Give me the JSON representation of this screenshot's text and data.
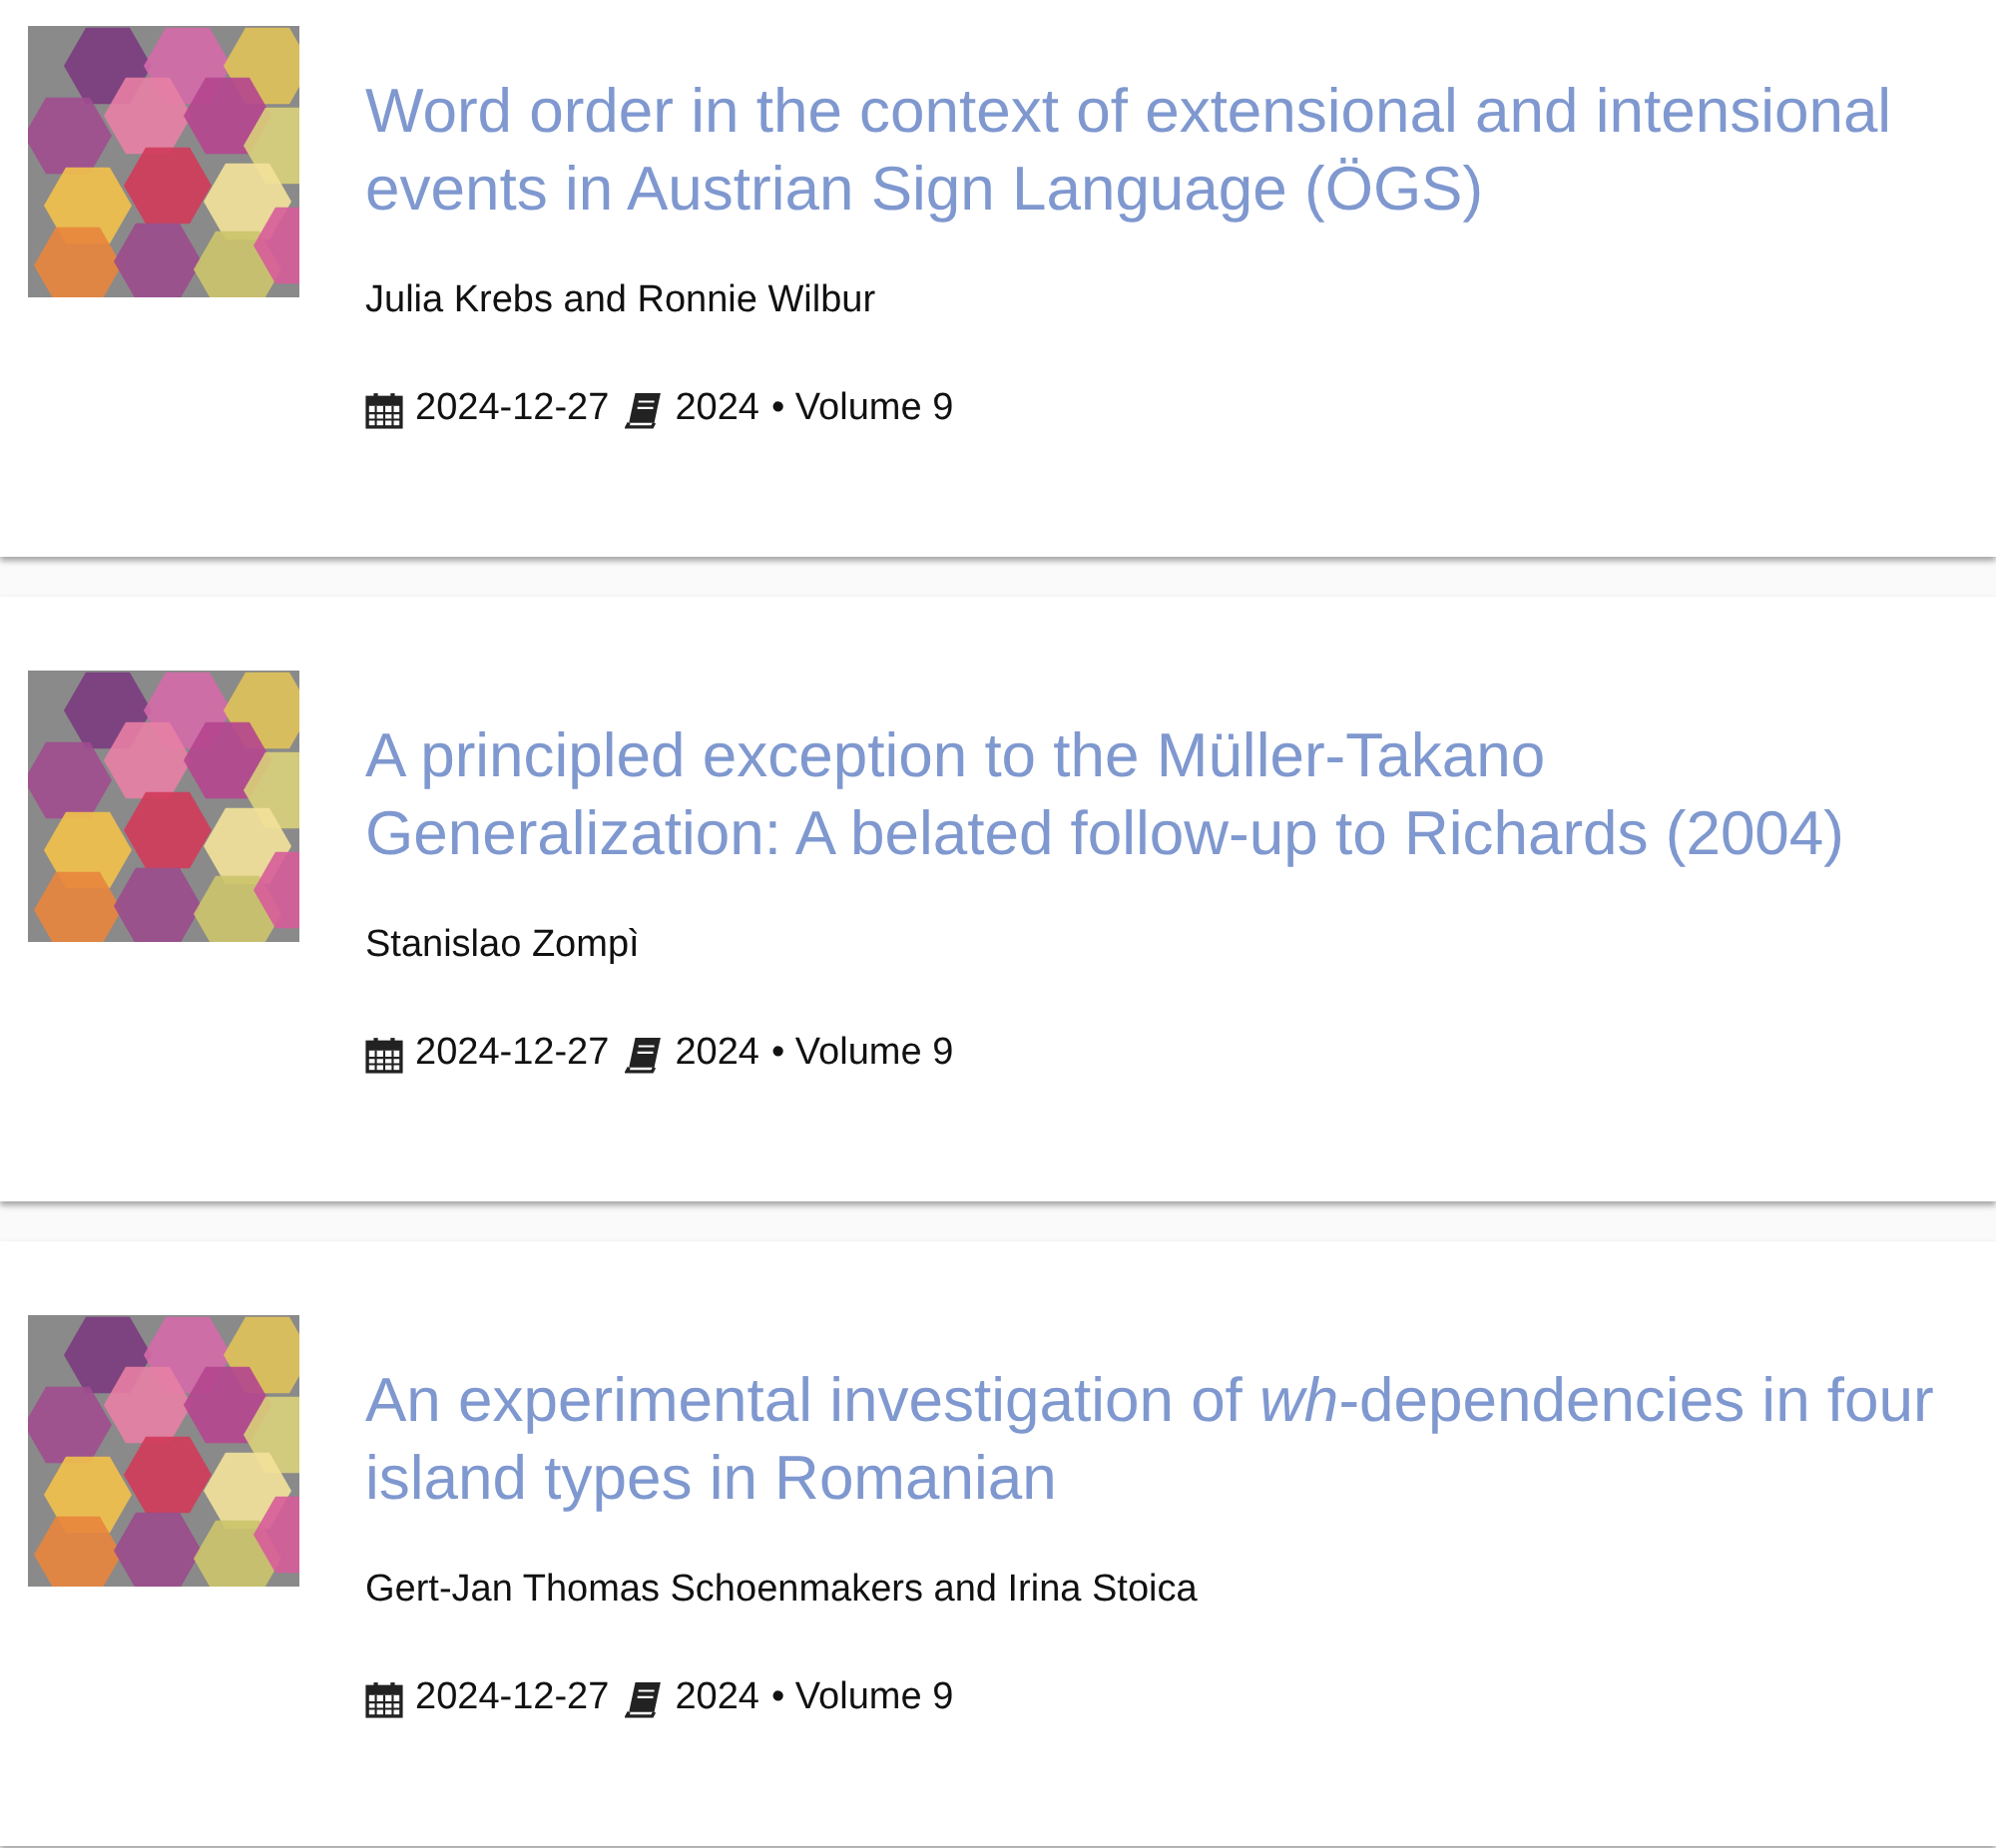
{
  "articles": [
    {
      "title": "Word order in the context of extensional and intensional events in Austrian Sign Language (ÖGS)",
      "authors": "Julia Krebs and Ronnie Wilbur",
      "date": "2024-12-27",
      "year": "2024",
      "volume": "• Volume 9"
    },
    {
      "title": "A principled exception to the Müller-Takano Generalization: A belated follow-up to Richards (2004)",
      "authors": "Stanislao Zompì",
      "date": "2024-12-27",
      "year": "2024",
      "volume": "• Volume 9"
    },
    {
      "title": "An experimental investigation of *wh*-dependencies in four island types in Romanian",
      "authors": "Gert-Jan Thomas Schoenmakers and Irina Stoica",
      "date": "2024-12-27",
      "year": "2024",
      "volume": "• Volume 9"
    }
  ]
}
